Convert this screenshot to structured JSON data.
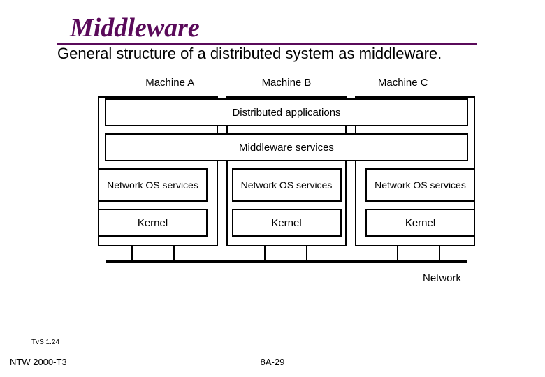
{
  "title": "Middleware",
  "subtitle": "General structure of a distributed system as middleware.",
  "machines": {
    "a": "Machine A",
    "b": "Machine B",
    "c": "Machine C"
  },
  "layers": {
    "distributed": "Distributed applications",
    "middleware": "Middleware services",
    "netos": "Network OS services",
    "kernel": "Kernel"
  },
  "network": "Network",
  "ref": "TvS 1.24",
  "footer": {
    "left": "NTW 2000-T3",
    "center": "8A-29"
  }
}
